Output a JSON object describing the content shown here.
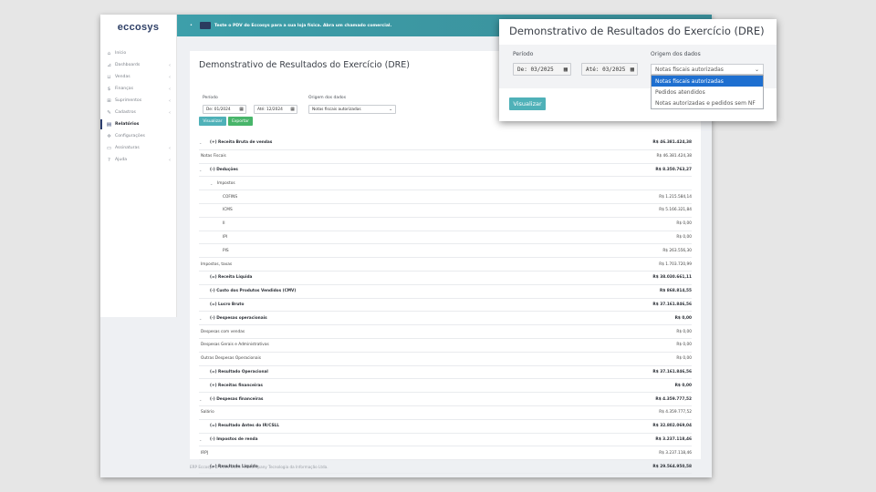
{
  "app": {
    "logo": "eccosys"
  },
  "topbar": {
    "dot": "•",
    "message": "Teste o PDV do Eccosys para a sua loja física. Abra um chamado comercial."
  },
  "sidebar": {
    "items": [
      {
        "label": "Início",
        "icon": "⌂",
        "chevron": ""
      },
      {
        "label": "Dashboards",
        "icon": "⊿",
        "chevron": "‹"
      },
      {
        "label": "Vendas",
        "icon": "⊔",
        "chevron": "‹"
      },
      {
        "label": "Finanças",
        "icon": "$",
        "chevron": "‹"
      },
      {
        "label": "Suprimentos",
        "icon": "⊞",
        "chevron": "‹"
      },
      {
        "label": "Cadastros",
        "icon": "✎",
        "chevron": "‹"
      },
      {
        "label": "Relatórios",
        "icon": "▤",
        "chevron": "",
        "active": true
      },
      {
        "label": "Configurações",
        "icon": "✲",
        "chevron": ""
      },
      {
        "label": "Assinaturas",
        "icon": "▭",
        "chevron": "‹"
      },
      {
        "label": "Ajuda",
        "icon": "?",
        "chevron": "‹"
      }
    ]
  },
  "main": {
    "title": "Demonstrativo de Resultados do Exercício (DRE)",
    "period_label": "Período",
    "from_label": "De:",
    "from_value": "01/2024",
    "to_label": "Até:",
    "to_value": "12/2024",
    "origin_label": "Origem dos dados",
    "origin_value": "Notas fiscais autorizadas",
    "visualize_label": "Visualizar",
    "export_label": "Exportar",
    "calendar_glyph": "▦",
    "arrow_glyph": "⌄"
  },
  "dre_rows": [
    {
      "label": "(+) Receita Bruta de vendas",
      "value": "R$ 46.381.424,38",
      "level": 0,
      "bold": true,
      "expand": "⌄"
    },
    {
      "label": "Notas Fiscais",
      "value": "R$ 46.381.424,38",
      "level": 1,
      "bold": false,
      "expand": ""
    },
    {
      "label": "(-) Deduções",
      "value": "R$ 8.350.763,27",
      "level": 0,
      "bold": true,
      "expand": "⌄"
    },
    {
      "label": "Impostos",
      "value": "",
      "level": 1,
      "bold": false,
      "expand": "⌄"
    },
    {
      "label": "COFINS",
      "value": "R$ 1.215.584,14",
      "level": 2,
      "bold": false,
      "expand": ""
    },
    {
      "label": "ICMS",
      "value": "R$ 5.166.321,84",
      "level": 2,
      "bold": false,
      "expand": ""
    },
    {
      "label": "II",
      "value": "R$ 0,00",
      "level": 2,
      "bold": false,
      "expand": ""
    },
    {
      "label": "IPI",
      "value": "R$ 0,00",
      "level": 2,
      "bold": false,
      "expand": ""
    },
    {
      "label": "PIS",
      "value": "R$ 263.556,30",
      "level": 2,
      "bold": false,
      "expand": ""
    },
    {
      "label": "Impostos, taxas",
      "value": "R$ 1.703.720,99",
      "level": 1,
      "bold": false,
      "expand": ""
    },
    {
      "label": "(=) Receita Líquida",
      "value": "R$ 38.030.661,11",
      "level": 0,
      "bold": true,
      "expand": ""
    },
    {
      "label": "(-) Custo dos Produtos Vendidos (CMV)",
      "value": "R$ 868.814,55",
      "level": 0,
      "bold": true,
      "expand": ""
    },
    {
      "label": "(=) Lucro Bruto",
      "value": "R$ 37.161.846,56",
      "level": 0,
      "bold": true,
      "expand": ""
    },
    {
      "label": "(-) Despesas operacionais",
      "value": "R$ 0,00",
      "level": 0,
      "bold": true,
      "expand": "⌄"
    },
    {
      "label": "Despesas com vendas",
      "value": "R$ 0,00",
      "level": 1,
      "bold": false,
      "expand": ""
    },
    {
      "label": "Despesas Gerais e Administrativas",
      "value": "R$ 0,00",
      "level": 1,
      "bold": false,
      "expand": ""
    },
    {
      "label": "Outras Despesas Operacionais",
      "value": "R$ 0,00",
      "level": 1,
      "bold": false,
      "expand": ""
    },
    {
      "label": "(=) Resultado Operacional",
      "value": "R$ 37.161.846,56",
      "level": 0,
      "bold": true,
      "expand": ""
    },
    {
      "label": "(+) Receitas financeiras",
      "value": "R$ 0,00",
      "level": 0,
      "bold": true,
      "expand": ""
    },
    {
      "label": "(-) Despesas financeiras",
      "value": "R$ 4.359.777,52",
      "level": 0,
      "bold": true,
      "expand": "⌄"
    },
    {
      "label": "Salário",
      "value": "R$ 4.359.777,52",
      "level": 1,
      "bold": false,
      "expand": ""
    },
    {
      "label": "(=) Resultado Antes do IR/CSLL",
      "value": "R$ 32.802.069,04",
      "level": 0,
      "bold": true,
      "expand": ""
    },
    {
      "label": "(-) Impostos de renda",
      "value": "R$ 3.237.118,46",
      "level": 0,
      "bold": true,
      "expand": "⌄"
    },
    {
      "label": "IRPJ",
      "value": "R$ 3.237.118,46",
      "level": 1,
      "bold": false,
      "expand": ""
    },
    {
      "label": "(=) Resultado Líquido",
      "value": "R$ 29.564.950,58",
      "level": 0,
      "bold": true,
      "expand": ""
    }
  ],
  "footer": {
    "text": "ERP Eccosys © 2011-2025 Fastcompany Tecnologia da Informação Ltda."
  },
  "popup": {
    "title": "Demonstrativo de Resultados do Exercício (DRE)",
    "period_label": "Período",
    "from_label": "De:",
    "from_value": "03/2025",
    "to_label": "Até:",
    "to_value": "03/2025",
    "origin_label": "Origem dos dados",
    "origin_value": "Notas fiscais autorizadas",
    "options": [
      "Notas fiscais autorizadas",
      "Pedidos atendidos",
      "Notas autorizadas e pedidos sem NF"
    ],
    "selected_index": 0,
    "visualize_label": "Visualizar"
  },
  "colors": {
    "topbar": "#3d9faa",
    "navy": "#2c3d6e",
    "teal_button": "#4fb1b8",
    "green_button": "#48b56a",
    "selected_option": "#1e6fd0"
  }
}
